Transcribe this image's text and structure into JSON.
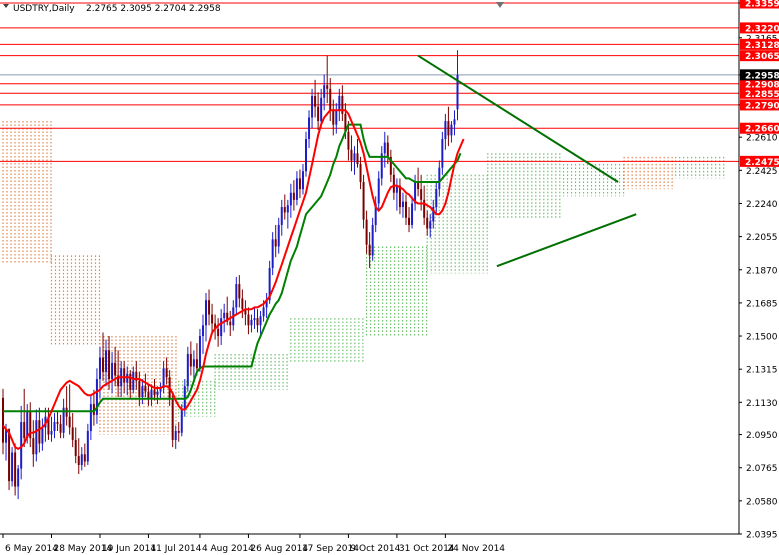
{
  "header": {
    "symbol": "USDTRY,Daily",
    "ohlc": "2.2765 2.3095 2.2704 2.2958"
  },
  "colors": {
    "level_line": "#ff0000",
    "level_label_bg": "#ff0000",
    "current_price_bg": "#000000",
    "ma_fast": "#ff0000",
    "ma_slow": "#008000",
    "trendline": "#007000",
    "cloud_bull": "#6fbf6f",
    "cloud_bear": "#e2844f",
    "candle_bull": "#1c1cc8",
    "candle_bear": "#7a0000",
    "grid": "#c0c0c0"
  },
  "chart_data": {
    "type": "candlestick",
    "series_name": "USDTRY,Daily",
    "last": {
      "open": 2.2765,
      "high": 2.3095,
      "low": 2.2704,
      "close": 2.2958
    },
    "current_price": 2.2958,
    "ylim": [
      2.0395,
      2.3359
    ],
    "y_ticks": [
      "2.3359",
      "2.3165",
      "2.2958",
      "2.2790",
      "2.2610",
      "2.2425",
      "2.2240",
      "2.2055",
      "2.1870",
      "2.1685",
      "2.1500",
      "2.1315",
      "2.1130",
      "2.0950",
      "2.0765",
      "2.0580",
      "2.0395"
    ],
    "x_ticks": [
      "6 May 2014",
      "28 May 2014",
      "19 Jun 2014",
      "11 Jul 2014",
      "4 Aug 2014",
      "26 Aug 2014",
      "17 Sep 2014",
      "9 Oct 2014",
      "31 Oct 2014",
      "24 Nov 2014"
    ],
    "horizontal_levels": [
      {
        "label": "2.3359",
        "value": 2.3359
      },
      {
        "label": "2.3220",
        "value": 2.322
      },
      {
        "label": "2.3128",
        "value": 2.3128
      },
      {
        "label": "2.3065",
        "value": 2.3065
      },
      {
        "label": "2.2908",
        "value": 2.2908
      },
      {
        "label": "2.2855",
        "value": 2.2855
      },
      {
        "label": "2.2790",
        "value": 2.279
      },
      {
        "label": "2.2660",
        "value": 2.266
      },
      {
        "label": "2.2475",
        "value": 2.2475
      }
    ],
    "trendlines": [
      {
        "from": {
          "x_index": 137,
          "y": 2.3065
        },
        "to": {
          "x_index": 203,
          "y": 2.236
        }
      },
      {
        "from": {
          "x_index": 163,
          "y": 2.189
        },
        "to": {
          "x_index": 209,
          "y": 2.218
        }
      }
    ],
    "candles": [
      [
        2.1155,
        2.1205,
        2.084,
        2.0905
      ],
      [
        2.0905,
        2.101,
        2.0805,
        2.098
      ],
      [
        2.098,
        2.0985,
        2.064,
        2.069
      ],
      [
        2.069,
        2.088,
        2.066,
        2.085
      ],
      [
        2.085,
        2.09,
        2.061,
        2.066
      ],
      [
        2.066,
        2.078,
        2.059,
        2.076
      ],
      [
        2.076,
        2.111,
        2.07,
        2.102
      ],
      [
        2.102,
        2.1205,
        2.088,
        2.093
      ],
      [
        2.093,
        2.112,
        2.09,
        2.108
      ],
      [
        2.108,
        2.113,
        2.088,
        2.093
      ],
      [
        2.093,
        2.103,
        2.077,
        2.084
      ],
      [
        2.084,
        2.109,
        2.08,
        2.103
      ],
      [
        2.103,
        2.11,
        2.085,
        2.09
      ],
      [
        2.09,
        2.104,
        2.086,
        2.099
      ],
      [
        2.099,
        2.11,
        2.091,
        2.105
      ],
      [
        2.105,
        2.11,
        2.092,
        2.095
      ],
      [
        2.095,
        2.105,
        2.091,
        2.097
      ],
      [
        2.097,
        2.107,
        2.093,
        2.102
      ],
      [
        2.102,
        2.108,
        2.097,
        2.101
      ],
      [
        2.101,
        2.106,
        2.093,
        2.096
      ],
      [
        2.096,
        2.115,
        2.093,
        2.11
      ],
      [
        2.11,
        2.122,
        2.1,
        2.105
      ],
      [
        2.105,
        2.123,
        2.095,
        2.099
      ],
      [
        2.099,
        2.107,
        2.088,
        2.092
      ],
      [
        2.092,
        2.099,
        2.079,
        2.083
      ],
      [
        2.083,
        2.093,
        2.073,
        2.078
      ],
      [
        2.078,
        2.088,
        2.075,
        2.084
      ],
      [
        2.084,
        2.09,
        2.077,
        2.08
      ],
      [
        2.08,
        2.101,
        2.078,
        2.097
      ],
      [
        2.097,
        2.117,
        2.092,
        2.112
      ],
      [
        2.112,
        2.12,
        2.1,
        2.106
      ],
      [
        2.106,
        2.132,
        2.101,
        2.126
      ],
      [
        2.126,
        2.144,
        2.115,
        2.138
      ],
      [
        2.138,
        2.152,
        2.125,
        2.13
      ],
      [
        2.13,
        2.148,
        2.122,
        2.142
      ],
      [
        2.142,
        2.15,
        2.12,
        2.126
      ],
      [
        2.126,
        2.141,
        2.118,
        2.135
      ],
      [
        2.135,
        2.144,
        2.122,
        2.128
      ],
      [
        2.128,
        2.142,
        2.116,
        2.122
      ],
      [
        2.122,
        2.136,
        2.116,
        2.132
      ],
      [
        2.132,
        2.136,
        2.118,
        2.124
      ],
      [
        2.124,
        2.133,
        2.117,
        2.129
      ],
      [
        2.129,
        2.131,
        2.115,
        2.12
      ],
      [
        2.12,
        2.133,
        2.118,
        2.13
      ],
      [
        2.13,
        2.136,
        2.12,
        2.125
      ],
      [
        2.125,
        2.13,
        2.111,
        2.116
      ],
      [
        2.116,
        2.126,
        2.112,
        2.122
      ],
      [
        2.122,
        2.129,
        2.116,
        2.119
      ],
      [
        2.119,
        2.123,
        2.111,
        2.115
      ],
      [
        2.115,
        2.123,
        2.111,
        2.12
      ],
      [
        2.12,
        2.126,
        2.114,
        2.117
      ],
      [
        2.117,
        2.122,
        2.112,
        2.119
      ],
      [
        2.119,
        2.124,
        2.115,
        2.121
      ],
      [
        2.121,
        2.136,
        2.118,
        2.132
      ],
      [
        2.132,
        2.138,
        2.123,
        2.127
      ],
      [
        2.127,
        2.131,
        2.111,
        2.115
      ],
      [
        2.115,
        2.119,
        2.088,
        2.092
      ],
      [
        2.092,
        2.1,
        2.087,
        2.097
      ],
      [
        2.097,
        2.102,
        2.091,
        2.096
      ],
      [
        2.096,
        2.112,
        2.094,
        2.109
      ],
      [
        2.109,
        2.126,
        2.105,
        2.122
      ],
      [
        2.122,
        2.144,
        2.119,
        2.14
      ],
      [
        2.14,
        2.147,
        2.128,
        2.133
      ],
      [
        2.133,
        2.142,
        2.125,
        2.137
      ],
      [
        2.137,
        2.146,
        2.128,
        2.132
      ],
      [
        2.132,
        2.154,
        2.13,
        2.15
      ],
      [
        2.15,
        2.162,
        2.14,
        2.156
      ],
      [
        2.156,
        2.174,
        2.147,
        2.17
      ],
      [
        2.17,
        2.176,
        2.156,
        2.162
      ],
      [
        2.162,
        2.168,
        2.151,
        2.157
      ],
      [
        2.157,
        2.162,
        2.148,
        2.154
      ],
      [
        2.154,
        2.16,
        2.144,
        2.15
      ],
      [
        2.15,
        2.165,
        2.145,
        2.16
      ],
      [
        2.16,
        2.168,
        2.152,
        2.163
      ],
      [
        2.163,
        2.172,
        2.156,
        2.158
      ],
      [
        2.158,
        2.164,
        2.15,
        2.156
      ],
      [
        2.156,
        2.17,
        2.153,
        2.166
      ],
      [
        2.166,
        2.183,
        2.162,
        2.179
      ],
      [
        2.179,
        2.184,
        2.166,
        2.171
      ],
      [
        2.171,
        2.176,
        2.16,
        2.165
      ],
      [
        2.165,
        2.17,
        2.156,
        2.162
      ],
      [
        2.162,
        2.166,
        2.151,
        2.156
      ],
      [
        2.156,
        2.162,
        2.152,
        2.159
      ],
      [
        2.159,
        2.166,
        2.154,
        2.16
      ],
      [
        2.16,
        2.165,
        2.152,
        2.156
      ],
      [
        2.156,
        2.164,
        2.15,
        2.161
      ],
      [
        2.161,
        2.17,
        2.158,
        2.166
      ],
      [
        2.166,
        2.174,
        2.16,
        2.17
      ],
      [
        2.17,
        2.192,
        2.168,
        2.188
      ],
      [
        2.188,
        2.208,
        2.184,
        2.204
      ],
      [
        2.204,
        2.212,
        2.194,
        2.2
      ],
      [
        2.2,
        2.216,
        2.196,
        2.212
      ],
      [
        2.212,
        2.226,
        2.206,
        2.222
      ],
      [
        2.222,
        2.229,
        2.215,
        2.219
      ],
      [
        2.219,
        2.226,
        2.21,
        2.223
      ],
      [
        2.223,
        2.235,
        2.216,
        2.23
      ],
      [
        2.23,
        2.237,
        2.22,
        2.226
      ],
      [
        2.226,
        2.242,
        2.223,
        2.238
      ],
      [
        2.238,
        2.243,
        2.227,
        2.232
      ],
      [
        2.232,
        2.246,
        2.229,
        2.242
      ],
      [
        2.242,
        2.264,
        2.239,
        2.26
      ],
      [
        2.26,
        2.276,
        2.255,
        2.272
      ],
      [
        2.272,
        2.288,
        2.266,
        2.284
      ],
      [
        2.284,
        2.293,
        2.272,
        2.278
      ],
      [
        2.278,
        2.286,
        2.265,
        2.27
      ],
      [
        2.27,
        2.288,
        2.266,
        2.283
      ],
      [
        2.283,
        2.296,
        2.276,
        2.29
      ],
      [
        2.29,
        2.3065,
        2.28,
        2.288
      ],
      [
        2.288,
        2.294,
        2.27,
        2.276
      ],
      [
        2.276,
        2.282,
        2.262,
        2.268
      ],
      [
        2.268,
        2.28,
        2.263,
        2.276
      ],
      [
        2.276,
        2.288,
        2.27,
        2.284
      ],
      [
        2.284,
        2.29,
        2.27,
        2.274
      ],
      [
        2.274,
        2.28,
        2.26,
        2.264
      ],
      [
        2.264,
        2.27,
        2.248,
        2.254
      ],
      [
        2.254,
        2.262,
        2.242,
        2.248
      ],
      [
        2.248,
        2.256,
        2.24,
        2.252
      ],
      [
        2.252,
        2.26,
        2.244,
        2.246
      ],
      [
        2.246,
        2.25,
        2.232,
        2.236
      ],
      [
        2.236,
        2.24,
        2.21,
        2.215
      ],
      [
        2.215,
        2.22,
        2.196,
        2.201
      ],
      [
        2.201,
        2.208,
        2.188,
        2.195
      ],
      [
        2.195,
        2.216,
        2.192,
        2.212
      ],
      [
        2.212,
        2.228,
        2.208,
        2.224
      ],
      [
        2.224,
        2.242,
        2.22,
        2.238
      ],
      [
        2.238,
        2.256,
        2.234,
        2.252
      ],
      [
        2.252,
        2.264,
        2.244,
        2.258
      ],
      [
        2.258,
        2.262,
        2.246,
        2.25
      ],
      [
        2.25,
        2.254,
        2.236,
        2.24
      ],
      [
        2.24,
        2.244,
        2.226,
        2.23
      ],
      [
        2.23,
        2.238,
        2.22,
        2.234
      ],
      [
        2.234,
        2.238,
        2.218,
        2.222
      ],
      [
        2.222,
        2.23,
        2.216,
        2.225
      ],
      [
        2.225,
        2.229,
        2.212,
        2.216
      ],
      [
        2.216,
        2.222,
        2.208,
        2.212
      ],
      [
        2.212,
        2.228,
        2.21,
        2.224
      ],
      [
        2.224,
        2.24,
        2.22,
        2.236
      ],
      [
        2.236,
        2.244,
        2.228,
        2.232
      ],
      [
        2.232,
        2.24,
        2.22,
        2.226
      ],
      [
        2.226,
        2.234,
        2.212,
        2.216
      ],
      [
        2.216,
        2.22,
        2.206,
        2.21
      ],
      [
        2.21,
        2.218,
        2.205,
        2.214
      ],
      [
        2.214,
        2.226,
        2.21,
        2.222
      ],
      [
        2.222,
        2.236,
        2.218,
        2.232
      ],
      [
        2.232,
        2.248,
        2.228,
        2.244
      ],
      [
        2.244,
        2.264,
        2.24,
        2.26
      ],
      [
        2.26,
        2.274,
        2.254,
        2.27
      ],
      [
        2.27,
        2.278,
        2.256,
        2.262
      ],
      [
        2.262,
        2.27,
        2.258,
        2.268
      ],
      [
        2.268,
        2.276,
        2.262,
        2.271
      ],
      [
        2.2765,
        2.3095,
        2.2704,
        2.2958
      ]
    ],
    "ma_fast": [
      2.1,
      2.098,
      2.096,
      2.092,
      2.088,
      2.087,
      2.088,
      2.09,
      2.094,
      2.096,
      2.096,
      2.097,
      2.098,
      2.099,
      2.101,
      2.104,
      2.108,
      2.112,
      2.116,
      2.12,
      2.122,
      2.124,
      2.125,
      2.124,
      2.123,
      2.122,
      2.12,
      2.118,
      2.117,
      2.117,
      2.118,
      2.119,
      2.12,
      2.122,
      2.123,
      2.124,
      2.125,
      2.126,
      2.127,
      2.127,
      2.127,
      2.127,
      2.127,
      2.126,
      2.126,
      2.126,
      2.125,
      2.124,
      2.123,
      2.122,
      2.121,
      2.121,
      2.121,
      2.122,
      2.122,
      2.121,
      2.118,
      2.114,
      2.111,
      2.109,
      2.109,
      2.111,
      2.114,
      2.117,
      2.12,
      2.125,
      2.132,
      2.14,
      2.146,
      2.152,
      2.154,
      2.156,
      2.157,
      2.158,
      2.159,
      2.16,
      2.161,
      2.162,
      2.163,
      2.164,
      2.165,
      2.165,
      2.165,
      2.166,
      2.166,
      2.167,
      2.168,
      2.17,
      2.172,
      2.176,
      2.18,
      2.185,
      2.19,
      2.195,
      2.2,
      2.205,
      2.21,
      2.215,
      2.22,
      2.225,
      2.23,
      2.238,
      2.246,
      2.254,
      2.262,
      2.268,
      2.272,
      2.274,
      2.276,
      2.276,
      2.276,
      2.276,
      2.276,
      2.276,
      2.274,
      2.27,
      2.266,
      2.262,
      2.258,
      2.252,
      2.244,
      2.236,
      2.228,
      2.222,
      2.22,
      2.222,
      2.226,
      2.23,
      2.233,
      2.234,
      2.234,
      2.233,
      2.232,
      2.23,
      2.229,
      2.227,
      2.225,
      2.224,
      2.224,
      2.224,
      2.223,
      2.222,
      2.22,
      2.218,
      2.218,
      2.22,
      2.224,
      2.23,
      2.238,
      2.246,
      2.252,
      2.256,
      2.26
    ],
    "ma_slow": [
      2.108,
      2.108,
      2.108,
      2.108,
      2.108,
      2.108,
      2.108,
      2.108,
      2.108,
      2.108,
      2.108,
      2.108,
      2.108,
      2.108,
      2.108,
      2.108,
      2.108,
      2.108,
      2.108,
      2.108,
      2.108,
      2.108,
      2.108,
      2.108,
      2.108,
      2.108,
      2.108,
      2.108,
      2.108,
      2.108,
      2.108,
      2.11,
      2.113,
      2.115,
      2.115,
      2.115,
      2.115,
      2.115,
      2.115,
      2.115,
      2.115,
      2.115,
      2.115,
      2.115,
      2.115,
      2.115,
      2.115,
      2.115,
      2.115,
      2.115,
      2.115,
      2.115,
      2.115,
      2.115,
      2.115,
      2.115,
      2.115,
      2.115,
      2.115,
      2.115,
      2.115,
      2.116,
      2.12,
      2.125,
      2.13,
      2.132,
      2.133,
      2.133,
      2.133,
      2.133,
      2.133,
      2.133,
      2.133,
      2.133,
      2.133,
      2.133,
      2.133,
      2.133,
      2.133,
      2.133,
      2.133,
      2.133,
      2.133,
      2.14,
      2.146,
      2.15,
      2.154,
      2.158,
      2.162,
      2.165,
      2.168,
      2.17,
      2.174,
      2.18,
      2.186,
      2.192,
      2.196,
      2.2,
      2.206,
      2.212,
      2.218,
      2.22,
      2.222,
      2.224,
      2.226,
      2.228,
      2.232,
      2.236,
      2.24,
      2.246,
      2.25,
      2.256,
      2.26,
      2.264,
      2.268,
      2.268,
      2.268,
      2.268,
      2.268,
      2.26,
      2.254,
      2.25,
      2.25,
      2.25,
      2.25,
      2.25,
      2.25,
      2.25,
      2.248,
      2.246,
      2.244,
      2.242,
      2.24,
      2.238,
      2.238,
      2.237,
      2.236,
      2.236,
      2.236,
      2.236,
      2.236,
      2.236,
      2.236,
      2.236,
      2.236,
      2.238,
      2.24,
      2.242,
      2.244,
      2.246,
      2.248,
      2.252
    ],
    "cloud": [
      {
        "from": 0,
        "to": 16,
        "type": "bear",
        "top": 2.27,
        "bottom": 2.19
      },
      {
        "from": 16,
        "to": 32,
        "type": "bear",
        "top": 2.195,
        "bottom": 2.145
      },
      {
        "from": 32,
        "to": 58,
        "type": "bear",
        "top": 2.15,
        "bottom": 2.095
      },
      {
        "from": 58,
        "to": 70,
        "type": "bull",
        "top": 2.125,
        "bottom": 2.105
      },
      {
        "from": 70,
        "to": 95,
        "type": "bull",
        "top": 2.14,
        "bottom": 2.12
      },
      {
        "from": 95,
        "to": 120,
        "type": "bull",
        "top": 2.16,
        "bottom": 2.135
      },
      {
        "from": 120,
        "to": 140,
        "type": "bull",
        "top": 2.2,
        "bottom": 2.15
      },
      {
        "from": 140,
        "to": 160,
        "type": "bull",
        "top": 2.24,
        "bottom": 2.185
      },
      {
        "from": 160,
        "to": 185,
        "type": "bull",
        "top": 2.252,
        "bottom": 2.215
      },
      {
        "from": 185,
        "to": 205,
        "type": "bull",
        "top": 2.246,
        "bottom": 2.228
      },
      {
        "from": 205,
        "to": 222,
        "type": "bear",
        "top": 2.25,
        "bottom": 2.232
      },
      {
        "from": 222,
        "to": 238,
        "type": "bull",
        "top": 2.25,
        "bottom": 2.238
      }
    ]
  }
}
